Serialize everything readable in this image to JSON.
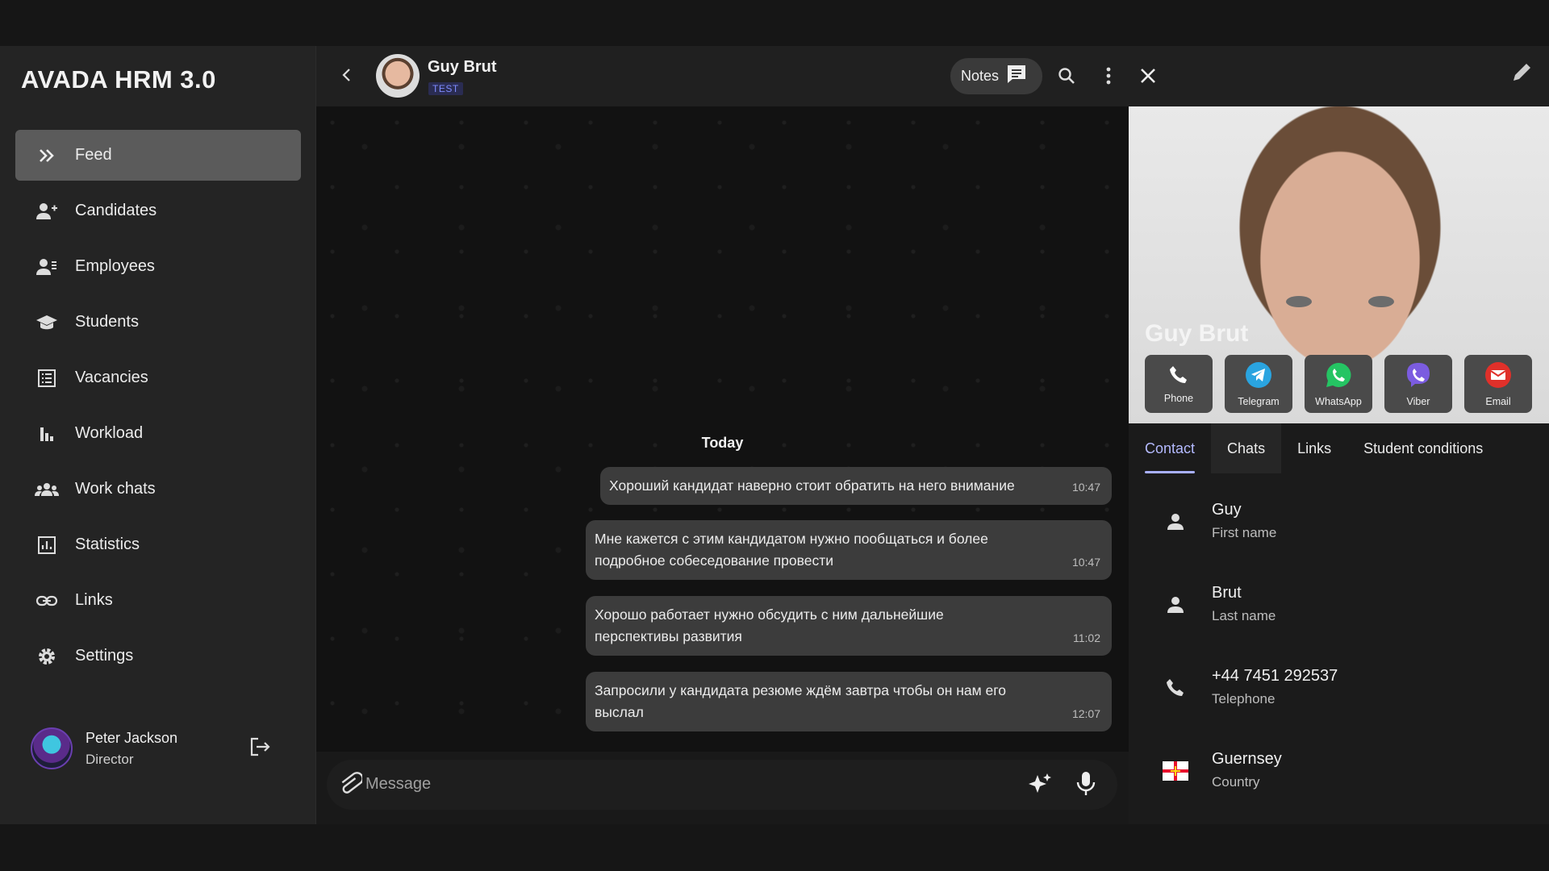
{
  "app": {
    "title": "AVADA HRM 3.0"
  },
  "sidebar": {
    "items": [
      {
        "label": "Feed",
        "icon": "double-chevron-icon",
        "active": true
      },
      {
        "label": "Candidates",
        "icon": "candidates-icon"
      },
      {
        "label": "Employees",
        "icon": "employees-icon"
      },
      {
        "label": "Students",
        "icon": "graduation-cap-icon"
      },
      {
        "label": "Vacancies",
        "icon": "list-icon"
      },
      {
        "label": "Workload",
        "icon": "bar-chart-icon"
      },
      {
        "label": "Work chats",
        "icon": "group-icon"
      },
      {
        "label": "Statistics",
        "icon": "statistics-icon"
      },
      {
        "label": "Links",
        "icon": "link-icon"
      },
      {
        "label": "Settings",
        "icon": "gear-icon"
      }
    ]
  },
  "user": {
    "name": "Peter Jackson",
    "role": "Director"
  },
  "chat": {
    "contact_name": "Guy Brut",
    "badge": "TEST",
    "notes_label": "Notes",
    "day_label": "Today",
    "messages": [
      {
        "text": "Хороший кандидат наверно стоит обратить на него внимание",
        "time": "10:47"
      },
      {
        "text": "Мне кажется с этим кандидатом нужно пообщаться и более подробное собеседование провести",
        "time": "10:47"
      },
      {
        "text": "Хорошо работает нужно обсудить с ним дальнейшие перспективы развития",
        "time": "11:02"
      },
      {
        "text": "Запросили у кандидата резюме ждём завтра чтобы он нам его выслал",
        "time": "12:07"
      }
    ],
    "composer": {
      "placeholder": "Message"
    }
  },
  "profile": {
    "name": "Guy Brut",
    "actions": [
      {
        "label": "Phone",
        "icon": "phone-icon",
        "color": "#ffffff"
      },
      {
        "label": "Telegram",
        "icon": "telegram-icon",
        "color": "#2aa4e0"
      },
      {
        "label": "WhatsApp",
        "icon": "whatsapp-icon",
        "color": "#25c463"
      },
      {
        "label": "Viber",
        "icon": "viber-icon",
        "color": "#7b5ce0"
      },
      {
        "label": "Email",
        "icon": "email-icon",
        "color": "#e0302a"
      }
    ],
    "tabs": [
      {
        "label": "Contact",
        "active": true
      },
      {
        "label": "Chats"
      },
      {
        "label": "Links"
      },
      {
        "label": "Student conditions"
      }
    ],
    "fields": [
      {
        "value": "Guy",
        "caption": "First name",
        "icon": "person-icon"
      },
      {
        "value": "Brut",
        "caption": "Last name",
        "icon": "person-icon"
      },
      {
        "value": "+44 7451 292537",
        "caption": "Telephone",
        "icon": "phone-icon"
      },
      {
        "value": "Guernsey",
        "caption": "Country",
        "icon": "flag-icon"
      }
    ]
  },
  "colors": {
    "accent": "#a9b0ff",
    "active_nav": "#5b5b5b",
    "bubble": "#3c3c3c"
  }
}
